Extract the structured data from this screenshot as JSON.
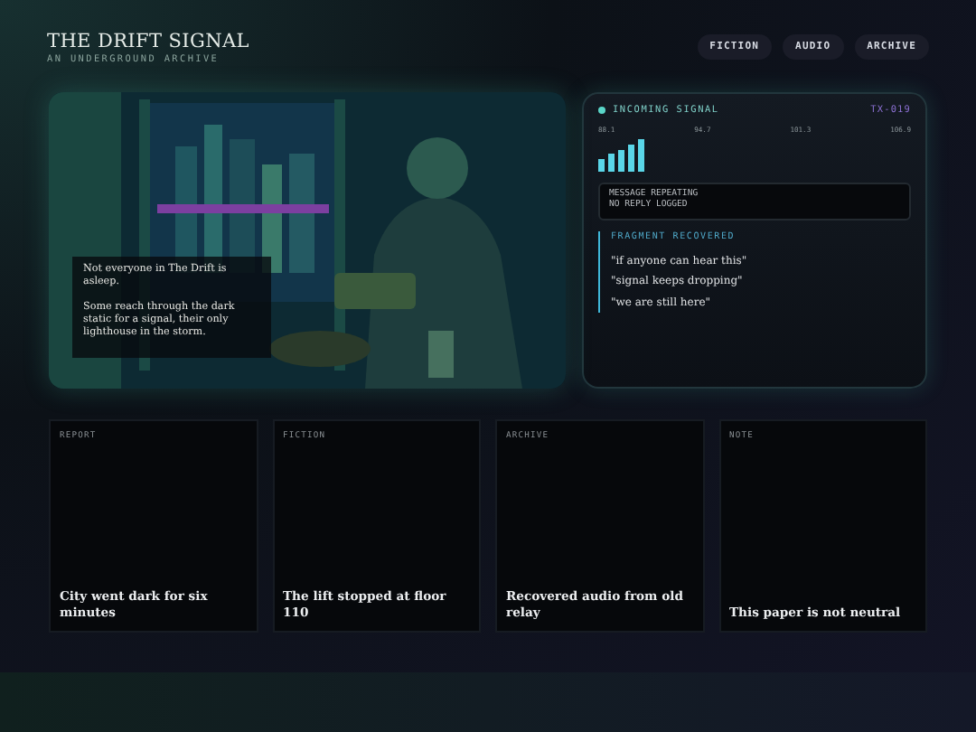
{
  "site": {
    "title": "THE DRIFT SIGNAL",
    "tagline": "AN UNDERGROUND ARCHIVE"
  },
  "nav": [
    "FICTION",
    "AUDIO",
    "ARCHIVE"
  ],
  "hero": {
    "kind": "picture",
    "caption": [
      "Not everyone in The Drift is asleep.",
      "Some reach through the dark static for a signal, their only lighthouse in the storm."
    ]
  },
  "signal": {
    "label": "INCOMING SIGNAL",
    "code": "TX-019",
    "frequencies": [
      "88.1",
      "94.7",
      "101.3",
      "106.9"
    ],
    "message": [
      "MESSAGE REPEATING",
      "NO REPLY LOGGED"
    ],
    "fragment_title": "FRAGMENT RECOVERED",
    "fragments": [
      "\"if anyone can hear this\"",
      "\"signal keeps dropping\"",
      "\"we are still here\""
    ]
  },
  "cards": [
    {
      "tag": "REPORT",
      "title": "City went dark for six minutes"
    },
    {
      "tag": "FICTION",
      "title": "The lift stopped at floor 110"
    },
    {
      "tag": "ARCHIVE",
      "title": "Recovered audio from old relay"
    },
    {
      "tag": "NOTE",
      "title": "This paper is not neutral"
    }
  ]
}
